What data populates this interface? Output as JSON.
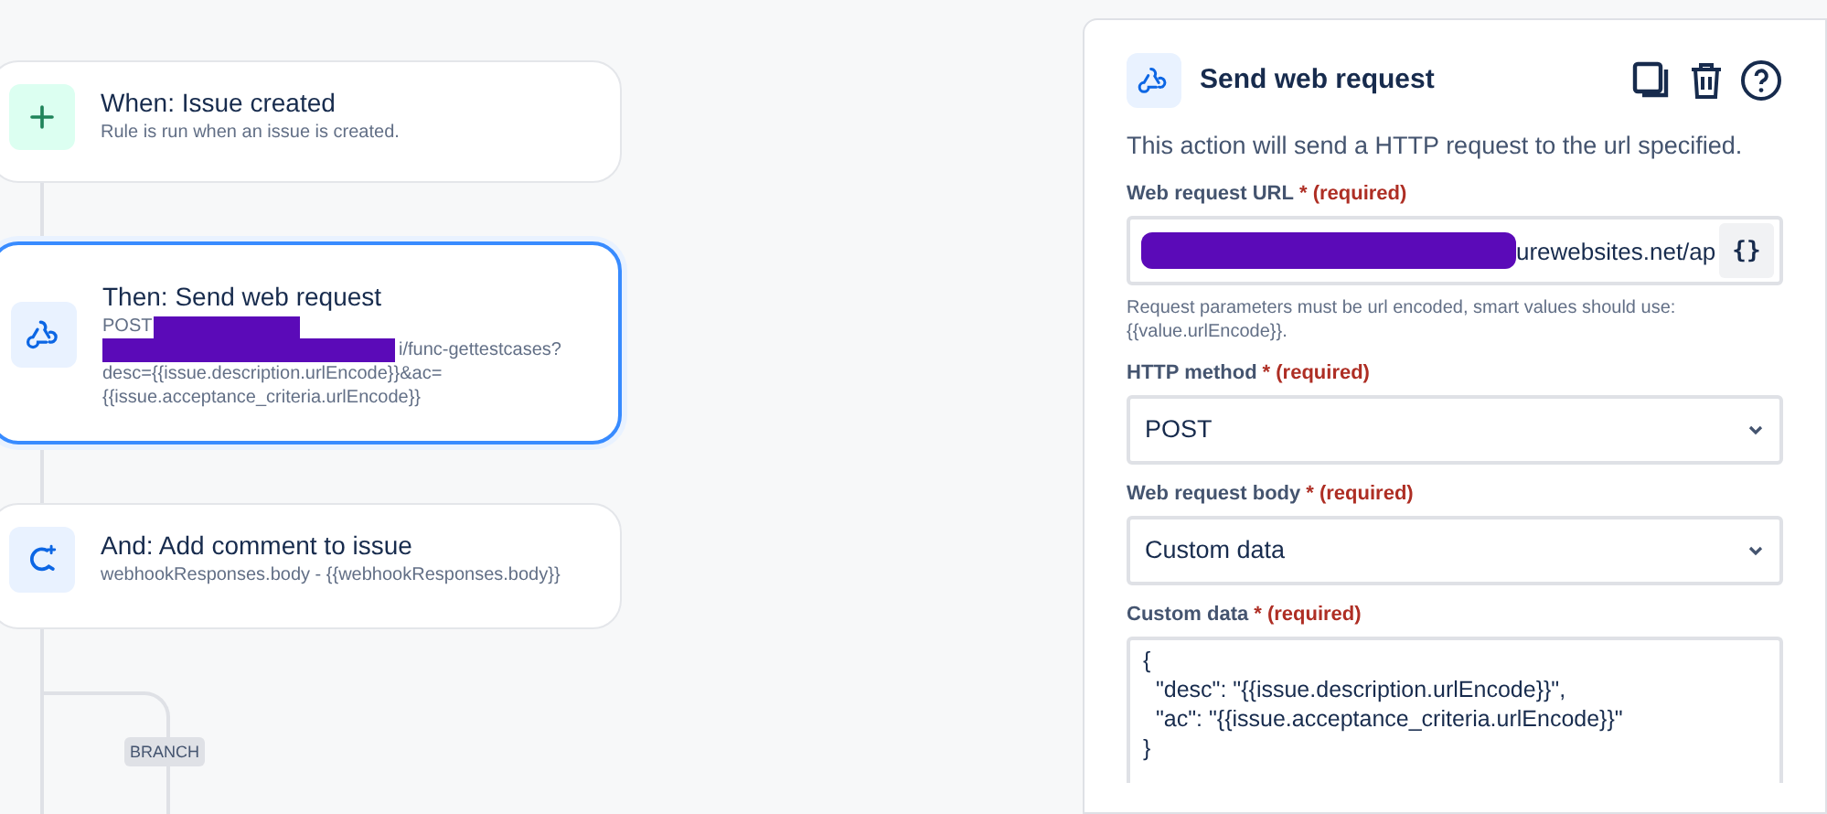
{
  "flow": {
    "steps": [
      {
        "kind": "trigger",
        "title": "When: Issue created",
        "details": [
          "Rule is run when an issue is created."
        ],
        "selected": false,
        "redacted": false
      },
      {
        "kind": "webhook",
        "title": "Then: Send web request",
        "details": [
          "POST",
          "i/func-gettestcases?",
          "desc={{issue.description.urlEncode}}&ac=",
          "{{issue.acceptance_criteria.urlEncode}}"
        ],
        "selected": true,
        "redacted": true
      },
      {
        "kind": "comment",
        "title": "And: Add comment to issue",
        "details": [
          "webhookResponses.body - {{webhookResponses.body}}"
        ],
        "selected": false,
        "redacted": false
      }
    ],
    "branch": {
      "label": "BRANCH"
    }
  },
  "panel": {
    "title": "Send web request",
    "description": "This action will send a HTTP request to the url specified.",
    "fields": [
      {
        "kind": "text",
        "label": "Web request URL",
        "required": "* (required)",
        "value": "urewebsites.net/ap",
        "redacted": true,
        "button": "{}",
        "help": "Request parameters must be url encoded, smart values should use: {{value.urlEncode}}."
      },
      {
        "kind": "select",
        "label": "HTTP method",
        "required": "* (required)",
        "value": "POST"
      },
      {
        "kind": "select",
        "label": "Web request body",
        "required": "* (required)",
        "value": "Custom data"
      },
      {
        "kind": "textarea",
        "label": "Custom data",
        "required": "* (required)",
        "lines": [
          "{",
          "  \"desc\": \"{{issue.description.urlEncode}}\",",
          "  \"ac\": \"{{issue.acceptance_criteria.urlEncode}}\"",
          "}"
        ]
      }
    ]
  }
}
